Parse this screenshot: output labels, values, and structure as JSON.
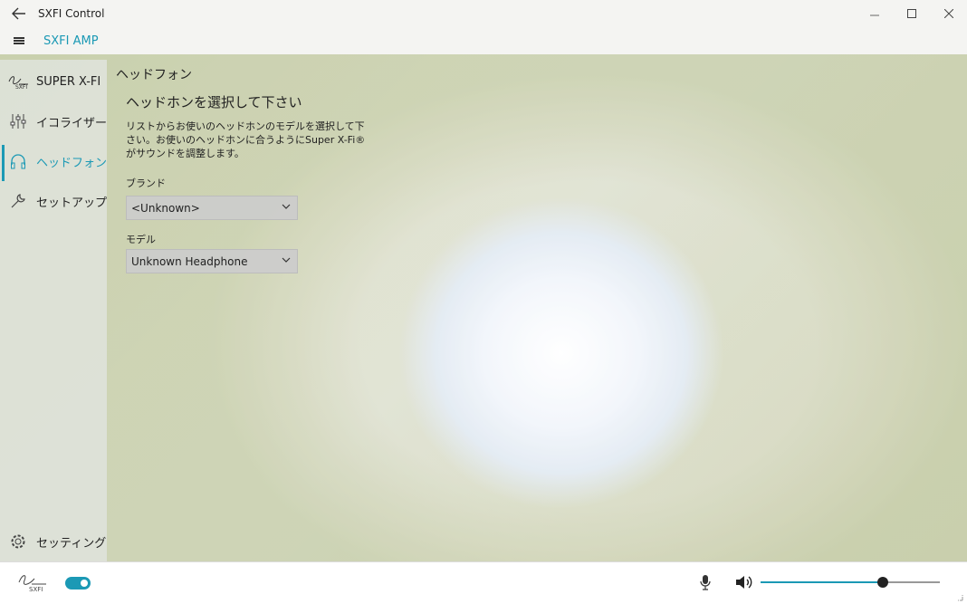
{
  "window": {
    "title": "SXFI Control",
    "back_icon": "back-arrow-icon",
    "controls": [
      "minimize-icon",
      "maximize-icon",
      "close-icon"
    ]
  },
  "header": {
    "menu_icon": "hamburger-icon",
    "device_name": "SXFI AMP"
  },
  "sidebar": {
    "items": [
      {
        "label": "SUPER X-FI",
        "icon": "super-xfi-logo-icon",
        "active": false
      },
      {
        "label": "イコライザー",
        "icon": "equalizer-icon",
        "active": false
      },
      {
        "label": "ヘッドフォン",
        "icon": "headphones-icon",
        "active": true
      },
      {
        "label": "セットアップ",
        "icon": "wrench-icon",
        "active": false
      }
    ],
    "settings": {
      "label": "セッティング",
      "icon": "gear-icon"
    }
  },
  "main": {
    "page_title": "ヘッドフォン",
    "section_title": "ヘッドホンを選択して下さい",
    "description": "リストからお使いのヘッドホンのモデルを選択して下さい。お使いのヘッドホンに合うようにSuper X-Fi® がサウンドを調整します。",
    "brand": {
      "label": "ブランド",
      "value": "<Unknown>"
    },
    "model": {
      "label": "モデル",
      "value": "Unknown Headphone"
    }
  },
  "bottom": {
    "logo_icon": "sxfi-logo-icon",
    "sxfi_enabled": true,
    "mic_icon": "microphone-icon",
    "speaker_icon": "speaker-icon",
    "volume_fraction": 0.68
  },
  "colors": {
    "accent": "#1b99b5"
  }
}
